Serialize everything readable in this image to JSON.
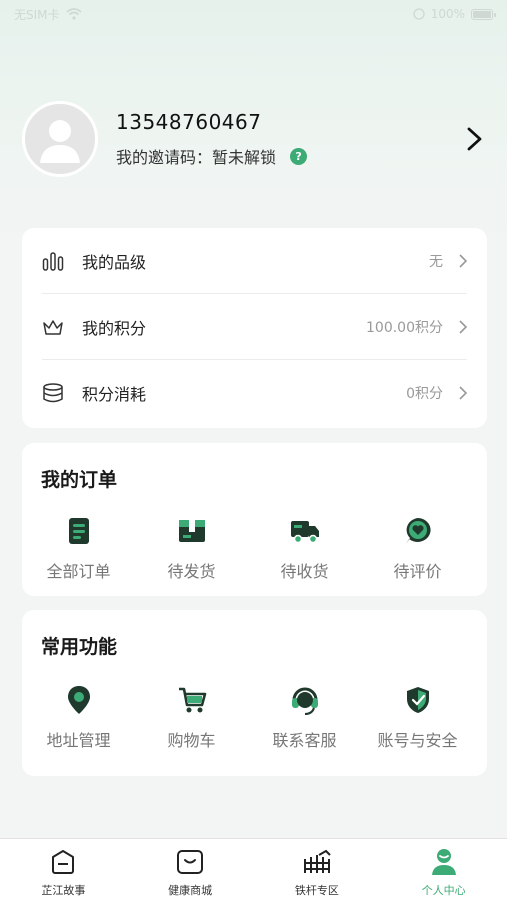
{
  "status_bar": {
    "carrier": "无SIM卡",
    "battery": "100%",
    "battery_level": 1.0
  },
  "profile": {
    "phone": "13548760467",
    "invite_label": "我的邀请码：",
    "invite_value": "暂未解锁",
    "help_glyph": "?"
  },
  "menu": [
    {
      "icon": "bar-chart-icon",
      "label": "我的品级",
      "value": "无"
    },
    {
      "icon": "crown-icon",
      "label": "我的积分",
      "value": "100.00积分"
    },
    {
      "icon": "coin-stack-icon",
      "label": "积分消耗",
      "value": "0积分"
    }
  ],
  "orders": {
    "title": "我的订单",
    "items": [
      {
        "icon": "order-list-icon",
        "label": "全部订单"
      },
      {
        "icon": "package-icon",
        "label": "待发货"
      },
      {
        "icon": "truck-icon",
        "label": "待收货"
      },
      {
        "icon": "review-heart-icon",
        "label": "待评价"
      }
    ]
  },
  "functions": {
    "title": "常用功能",
    "items": [
      {
        "icon": "location-pin-icon",
        "label": "地址管理"
      },
      {
        "icon": "shopping-cart-icon",
        "label": "购物车"
      },
      {
        "icon": "headset-icon",
        "label": "联系客服"
      },
      {
        "icon": "shield-check-icon",
        "label": "账号与安全"
      }
    ]
  },
  "tabbar": [
    {
      "icon": "story-icon",
      "label": "芷江故事",
      "active": false
    },
    {
      "icon": "shop-bag-icon",
      "label": "健康商城",
      "active": false
    },
    {
      "icon": "fence-icon",
      "label": "铁杆专区",
      "active": false
    },
    {
      "icon": "person-icon",
      "label": "个人中心",
      "active": true
    }
  ],
  "colors": {
    "accent": "#3dab75",
    "icon_dark": "#1f3a2c",
    "icon_green": "#3dab75"
  }
}
